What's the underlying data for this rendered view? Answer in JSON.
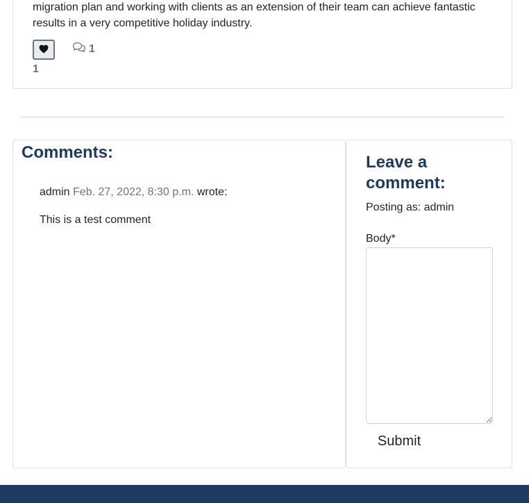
{
  "post": {
    "excerpt": "migration plan and working with clients as an extension of their team can achieve fantastic results in a very competitive holiday industry.",
    "like_count": "1",
    "comment_count": "1",
    "icons": {
      "like": "heart-icon",
      "comments": "comments-icon"
    }
  },
  "comments": {
    "heading": "Comments:",
    "items": [
      {
        "author": "admin",
        "date": "Feb. 27, 2022, 8:30 p.m.",
        "wrote": "wrote:",
        "body": "This is a test comment"
      }
    ]
  },
  "leave_comment": {
    "heading": "Leave a comment:",
    "posting_as": "Posting as: admin",
    "body_label": "Body",
    "required_marker": "*",
    "body_value": "",
    "submit_label": "Submit"
  },
  "colors": {
    "accent": "#1e3a63",
    "muted": "#6c757d",
    "border": "#dcdfe3"
  }
}
